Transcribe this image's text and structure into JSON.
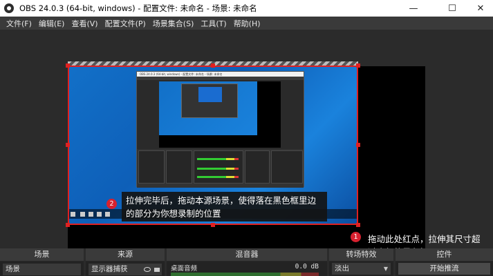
{
  "window": {
    "title": "OBS 24.0.3 (64-bit, windows) - 配置文件: 未命名 - 场景: 未命名",
    "minimize": "—",
    "maximize": "☐",
    "close": "✕"
  },
  "menu": [
    "文件(F)",
    "编辑(E)",
    "查看(V)",
    "配置文件(P)",
    "场景集合(S)",
    "工具(T)",
    "帮助(H)"
  ],
  "inner_screenshot": {
    "title": "OBS 24.0.3 (64-bit, windows) - 配置文件: 未命名 - 场景: 未命名"
  },
  "callouts": {
    "step2": {
      "badge": "2",
      "lines": [
        "拉伸完毕后，拖动本源场景，使得落在黑色框里边",
        "的部分为你想录制的位置"
      ]
    },
    "step1": {
      "badge": "1",
      "lines": [
        "拖动此处红点，拉伸其尺寸超",
        "过底部的黑色框"
      ]
    }
  },
  "docks": {
    "scenes": {
      "header": "场景",
      "item": "场景"
    },
    "sources": {
      "header": "来源",
      "item": "显示器捕获"
    },
    "mixer": {
      "header": "混音器",
      "track": "桌面音频",
      "db": "0.0 dB"
    },
    "transitions": {
      "header": "转场特效",
      "selected": "淡出"
    },
    "controls": {
      "header": "控件",
      "start_stream": "开始推流"
    }
  },
  "colors": {
    "accent_red": "#e02020",
    "badge_red": "#d8212f",
    "desktop_blue": "#1270c8"
  }
}
